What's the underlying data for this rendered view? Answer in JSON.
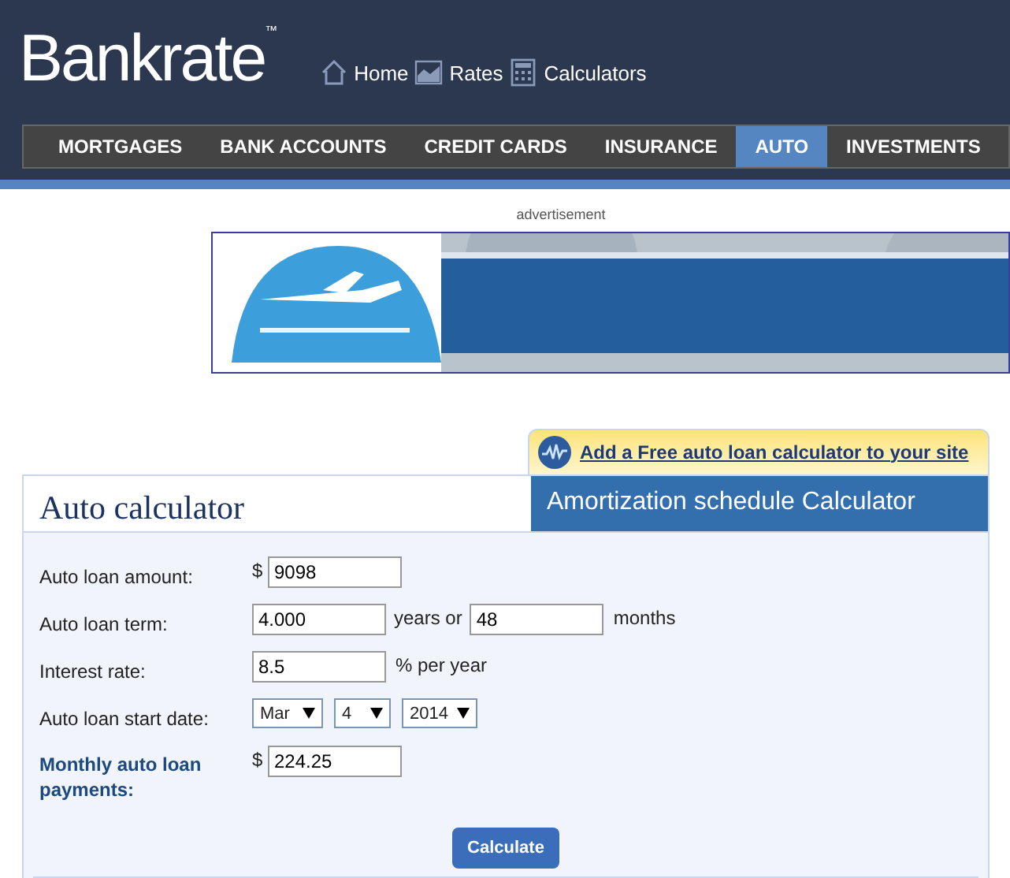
{
  "header": {
    "logo": "Bankrate",
    "logo_mark": "™",
    "links": [
      {
        "label": "Home"
      },
      {
        "label": "Rates"
      },
      {
        "label": "Calculators"
      }
    ]
  },
  "nav": [
    {
      "label": "MORTGAGES",
      "selected": false
    },
    {
      "label": "BANK ACCOUNTS",
      "selected": false
    },
    {
      "label": "CREDIT CARDS",
      "selected": false
    },
    {
      "label": "INSURANCE",
      "selected": false
    },
    {
      "label": "AUTO",
      "selected": true
    },
    {
      "label": "INVESTMENTS",
      "selected": false
    }
  ],
  "ad": {
    "label": "advertisement",
    "kind": "picture"
  },
  "widget_link": "Add a Free auto loan calculator to your site",
  "calculator": {
    "title": "Auto calculator",
    "tab": "Amortization schedule Calculator",
    "rows": [
      {
        "kind": "currency",
        "label": "Auto loan amount:",
        "prefix": "$",
        "value": "9098"
      },
      {
        "kind": "term",
        "label": "Auto loan term:",
        "value": "4.000",
        "middle": "years or",
        "value2": "48",
        "suffix": "months"
      },
      {
        "kind": "percent",
        "label": "Interest rate:",
        "value": "8.5",
        "suffix": "% per year"
      },
      {
        "kind": "date",
        "label": "Auto loan start date:",
        "selects": [
          "Mar",
          "4",
          "2014"
        ]
      },
      {
        "kind": "result",
        "label": "Monthly auto loan payments:",
        "prefix": "$",
        "value": "224.25"
      }
    ],
    "button": "Calculate"
  }
}
